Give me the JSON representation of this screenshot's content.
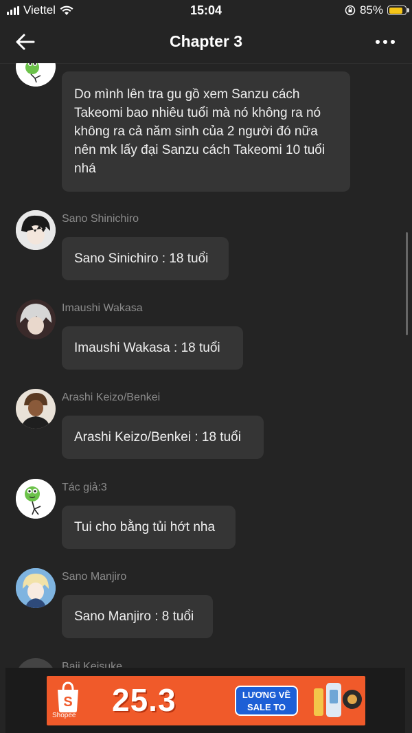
{
  "status_bar": {
    "carrier": "Viettel",
    "time": "15:04",
    "battery": "85%",
    "battery_level": 0.85
  },
  "header": {
    "title": "Chapter 3"
  },
  "messages": [
    {
      "sender": "",
      "text": "Do mình lên tra gu gồ xem Sanzu cách Takeomi bao nhiêu tuổi mà nó không ra nó không ra cả năm sinh của 2 người đó nữa nên mk lấy đại Sanzu cách Takeomi 10 tuổi nhá",
      "avatar": "frog-author-avatar"
    },
    {
      "sender": "Sano Shinichiro",
      "text": "Sano Sinichiro : 18 tuổi",
      "avatar": "dark-hair-avatar"
    },
    {
      "sender": "Imaushi Wakasa",
      "text": "Imaushi Wakasa : 18 tuổi",
      "avatar": "white-hair-avatar"
    },
    {
      "sender": "Arashi Keizo/Benkei",
      "text": "Arashi Keizo/Benkei : 18 tuổi",
      "avatar": "tan-avatar"
    },
    {
      "sender": "Tác giả:3",
      "text": "Tui cho bằng tủi hớt nha",
      "avatar": "frog-author-avatar"
    },
    {
      "sender": "Sano Manjiro",
      "text": "Sano Manjiro : 8 tuổi",
      "avatar": "blonde-avatar"
    },
    {
      "sender": "Baji Keisuke",
      "text": "",
      "avatar": "partial-avatar"
    }
  ],
  "ad": {
    "brand": "Shopee",
    "headline": "25.3",
    "tag_line1": "LƯƠNG VỀ",
    "tag_line2": "SALE TO",
    "colors": {
      "bg": "#f05a2a",
      "tag": "#1d5fd6"
    }
  }
}
